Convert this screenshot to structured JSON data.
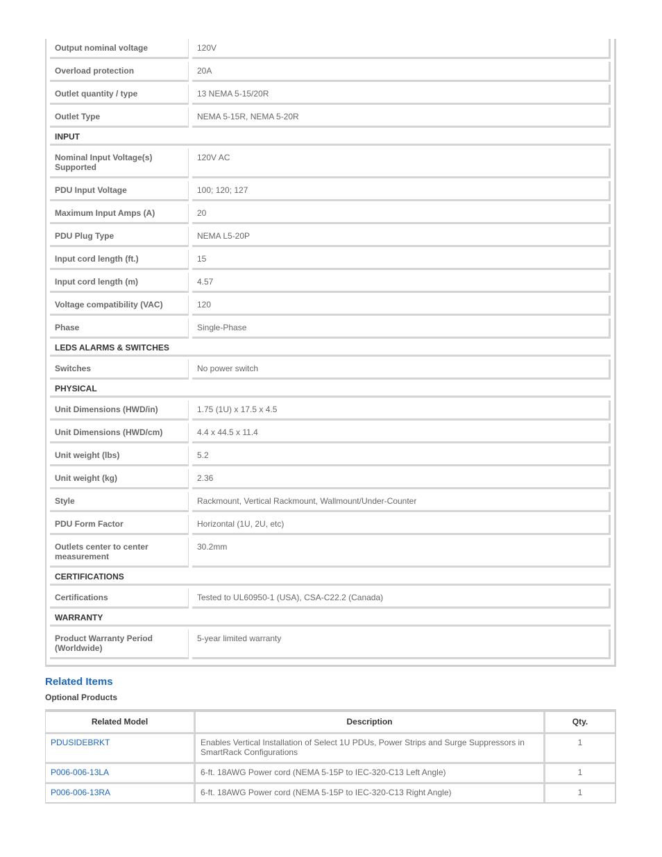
{
  "spec_rows": [
    {
      "type": "row",
      "label": "Output nominal voltage",
      "value": "120V"
    },
    {
      "type": "row",
      "label": "Overload protection",
      "value": "20A"
    },
    {
      "type": "row",
      "label": "Outlet quantity / type",
      "value": "13 NEMA 5-15/20R"
    },
    {
      "type": "row",
      "label": "Outlet Type",
      "value": "NEMA 5-15R, NEMA 5-20R"
    },
    {
      "type": "section",
      "label": "INPUT"
    },
    {
      "type": "row",
      "label": "Nominal Input Voltage(s) Supported",
      "value": "120V AC",
      "tall": true
    },
    {
      "type": "row",
      "label": "PDU Input Voltage",
      "value": "100; 120; 127"
    },
    {
      "type": "row",
      "label": "Maximum Input Amps (A)",
      "value": "20"
    },
    {
      "type": "row",
      "label": "PDU Plug Type",
      "value": "NEMA L5-20P"
    },
    {
      "type": "row",
      "label": "Input cord length (ft.)",
      "value": "15"
    },
    {
      "type": "row",
      "label": "Input cord length (m)",
      "value": "4.57"
    },
    {
      "type": "row",
      "label": "Voltage compatibility (VAC)",
      "value": "120"
    },
    {
      "type": "row",
      "label": "Phase",
      "value": "Single-Phase"
    },
    {
      "type": "section",
      "label": "LEDS ALARMS & SWITCHES"
    },
    {
      "type": "row",
      "label": "Switches",
      "value": "No power switch"
    },
    {
      "type": "section",
      "label": "PHYSICAL"
    },
    {
      "type": "row",
      "label": "Unit Dimensions (HWD/in)",
      "value": "1.75 (1U) x 17.5 x 4.5"
    },
    {
      "type": "row",
      "label": "Unit Dimensions (HWD/cm)",
      "value": "4.4 x 44.5 x 11.4"
    },
    {
      "type": "row",
      "label": "Unit weight (lbs)",
      "value": "5.2"
    },
    {
      "type": "row",
      "label": "Unit weight (kg)",
      "value": "2.36"
    },
    {
      "type": "row",
      "label": "Style",
      "value": "Rackmount, Vertical Rackmount, Wallmount/Under-Counter"
    },
    {
      "type": "row",
      "label": "PDU Form Factor",
      "value": "Horizontal (1U, 2U, etc)"
    },
    {
      "type": "row",
      "label": "Outlets center to center measurement",
      "value": "30.2mm",
      "tall": true
    },
    {
      "type": "section",
      "label": "CERTIFICATIONS"
    },
    {
      "type": "row",
      "label": "Certifications",
      "value": "Tested to UL60950-1 (USA), CSA-C22.2 (Canada)"
    },
    {
      "type": "section",
      "label": "WARRANTY"
    },
    {
      "type": "row",
      "label": "Product Warranty Period (Worldwide)",
      "value": "5-year limited warranty",
      "tall": true
    }
  ],
  "related": {
    "title": "Related Items",
    "subtitle": "Optional Products",
    "columns": [
      "Related Model",
      "Description",
      "Qty."
    ],
    "rows": [
      {
        "model": "PDUSIDEBRKT",
        "description": "Enables Vertical Installation of Select 1U PDUs, Power Strips and Surge Suppressors in SmartRack Configurations",
        "qty": "1"
      },
      {
        "model": "P006-006-13LA",
        "description": "6-ft. 18AWG Power cord (NEMA 5-15P to IEC-320-C13 Left Angle)",
        "qty": "1"
      },
      {
        "model": "P006-006-13RA",
        "description": "6-ft. 18AWG Power cord (NEMA 5-15P to IEC-320-C13 Right Angle)",
        "qty": "1"
      }
    ]
  },
  "colors": {
    "link": "#1a66c2",
    "border": "#d4d4d4"
  }
}
